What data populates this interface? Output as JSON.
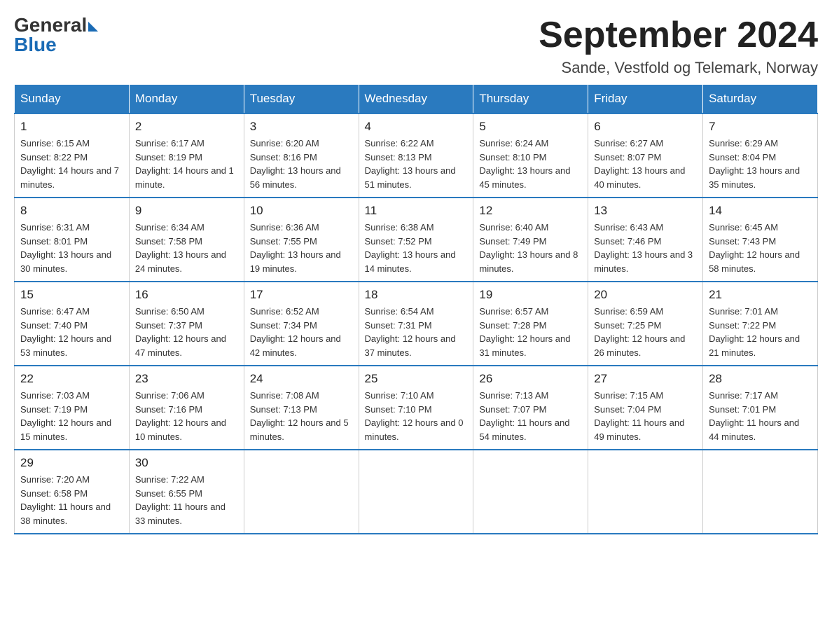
{
  "header": {
    "logo": {
      "general": "General",
      "blue": "Blue"
    },
    "title": "September 2024",
    "location": "Sande, Vestfold og Telemark, Norway"
  },
  "days_of_week": [
    "Sunday",
    "Monday",
    "Tuesday",
    "Wednesday",
    "Thursday",
    "Friday",
    "Saturday"
  ],
  "weeks": [
    [
      {
        "day": "1",
        "sunrise": "6:15 AM",
        "sunset": "8:22 PM",
        "daylight": "14 hours and 7 minutes."
      },
      {
        "day": "2",
        "sunrise": "6:17 AM",
        "sunset": "8:19 PM",
        "daylight": "14 hours and 1 minute."
      },
      {
        "day": "3",
        "sunrise": "6:20 AM",
        "sunset": "8:16 PM",
        "daylight": "13 hours and 56 minutes."
      },
      {
        "day": "4",
        "sunrise": "6:22 AM",
        "sunset": "8:13 PM",
        "daylight": "13 hours and 51 minutes."
      },
      {
        "day": "5",
        "sunrise": "6:24 AM",
        "sunset": "8:10 PM",
        "daylight": "13 hours and 45 minutes."
      },
      {
        "day": "6",
        "sunrise": "6:27 AM",
        "sunset": "8:07 PM",
        "daylight": "13 hours and 40 minutes."
      },
      {
        "day": "7",
        "sunrise": "6:29 AM",
        "sunset": "8:04 PM",
        "daylight": "13 hours and 35 minutes."
      }
    ],
    [
      {
        "day": "8",
        "sunrise": "6:31 AM",
        "sunset": "8:01 PM",
        "daylight": "13 hours and 30 minutes."
      },
      {
        "day": "9",
        "sunrise": "6:34 AM",
        "sunset": "7:58 PM",
        "daylight": "13 hours and 24 minutes."
      },
      {
        "day": "10",
        "sunrise": "6:36 AM",
        "sunset": "7:55 PM",
        "daylight": "13 hours and 19 minutes."
      },
      {
        "day": "11",
        "sunrise": "6:38 AM",
        "sunset": "7:52 PM",
        "daylight": "13 hours and 14 minutes."
      },
      {
        "day": "12",
        "sunrise": "6:40 AM",
        "sunset": "7:49 PM",
        "daylight": "13 hours and 8 minutes."
      },
      {
        "day": "13",
        "sunrise": "6:43 AM",
        "sunset": "7:46 PM",
        "daylight": "13 hours and 3 minutes."
      },
      {
        "day": "14",
        "sunrise": "6:45 AM",
        "sunset": "7:43 PM",
        "daylight": "12 hours and 58 minutes."
      }
    ],
    [
      {
        "day": "15",
        "sunrise": "6:47 AM",
        "sunset": "7:40 PM",
        "daylight": "12 hours and 53 minutes."
      },
      {
        "day": "16",
        "sunrise": "6:50 AM",
        "sunset": "7:37 PM",
        "daylight": "12 hours and 47 minutes."
      },
      {
        "day": "17",
        "sunrise": "6:52 AM",
        "sunset": "7:34 PM",
        "daylight": "12 hours and 42 minutes."
      },
      {
        "day": "18",
        "sunrise": "6:54 AM",
        "sunset": "7:31 PM",
        "daylight": "12 hours and 37 minutes."
      },
      {
        "day": "19",
        "sunrise": "6:57 AM",
        "sunset": "7:28 PM",
        "daylight": "12 hours and 31 minutes."
      },
      {
        "day": "20",
        "sunrise": "6:59 AM",
        "sunset": "7:25 PM",
        "daylight": "12 hours and 26 minutes."
      },
      {
        "day": "21",
        "sunrise": "7:01 AM",
        "sunset": "7:22 PM",
        "daylight": "12 hours and 21 minutes."
      }
    ],
    [
      {
        "day": "22",
        "sunrise": "7:03 AM",
        "sunset": "7:19 PM",
        "daylight": "12 hours and 15 minutes."
      },
      {
        "day": "23",
        "sunrise": "7:06 AM",
        "sunset": "7:16 PM",
        "daylight": "12 hours and 10 minutes."
      },
      {
        "day": "24",
        "sunrise": "7:08 AM",
        "sunset": "7:13 PM",
        "daylight": "12 hours and 5 minutes."
      },
      {
        "day": "25",
        "sunrise": "7:10 AM",
        "sunset": "7:10 PM",
        "daylight": "12 hours and 0 minutes."
      },
      {
        "day": "26",
        "sunrise": "7:13 AM",
        "sunset": "7:07 PM",
        "daylight": "11 hours and 54 minutes."
      },
      {
        "day": "27",
        "sunrise": "7:15 AM",
        "sunset": "7:04 PM",
        "daylight": "11 hours and 49 minutes."
      },
      {
        "day": "28",
        "sunrise": "7:17 AM",
        "sunset": "7:01 PM",
        "daylight": "11 hours and 44 minutes."
      }
    ],
    [
      {
        "day": "29",
        "sunrise": "7:20 AM",
        "sunset": "6:58 PM",
        "daylight": "11 hours and 38 minutes."
      },
      {
        "day": "30",
        "sunrise": "7:22 AM",
        "sunset": "6:55 PM",
        "daylight": "11 hours and 33 minutes."
      },
      null,
      null,
      null,
      null,
      null
    ]
  ]
}
